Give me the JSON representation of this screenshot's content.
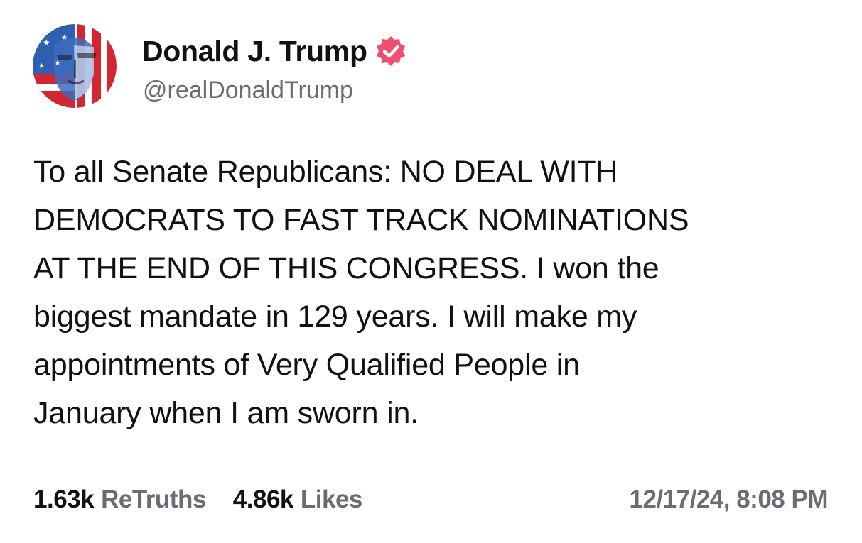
{
  "post": {
    "author": {
      "display_name": "Donald J. Trump",
      "handle": "@realDonaldTrump",
      "verified": true,
      "verified_badge_icon": "verified-check-icon",
      "avatar_icon": "profile-avatar"
    },
    "text": "To all Senate Republicans: NO DEAL WITH\nDEMOCRATS TO FAST TRACK NOMINATIONS\nAT THE END OF THIS CONGRESS. I won the\nbiggest mandate in 129 years. I will make my\nappointments of Very Qualified People in\nJanuary when I am sworn in.",
    "stats": {
      "retruths_count": "1.63k",
      "retruths_label": "ReTruths",
      "likes_count": "4.86k",
      "likes_label": "Likes"
    },
    "timestamp": "12/17/24, 8:08 PM"
  },
  "colors": {
    "text_primary": "#111111",
    "text_secondary": "#6b6b76",
    "badge": "#f04f72",
    "background": "#ffffff"
  }
}
